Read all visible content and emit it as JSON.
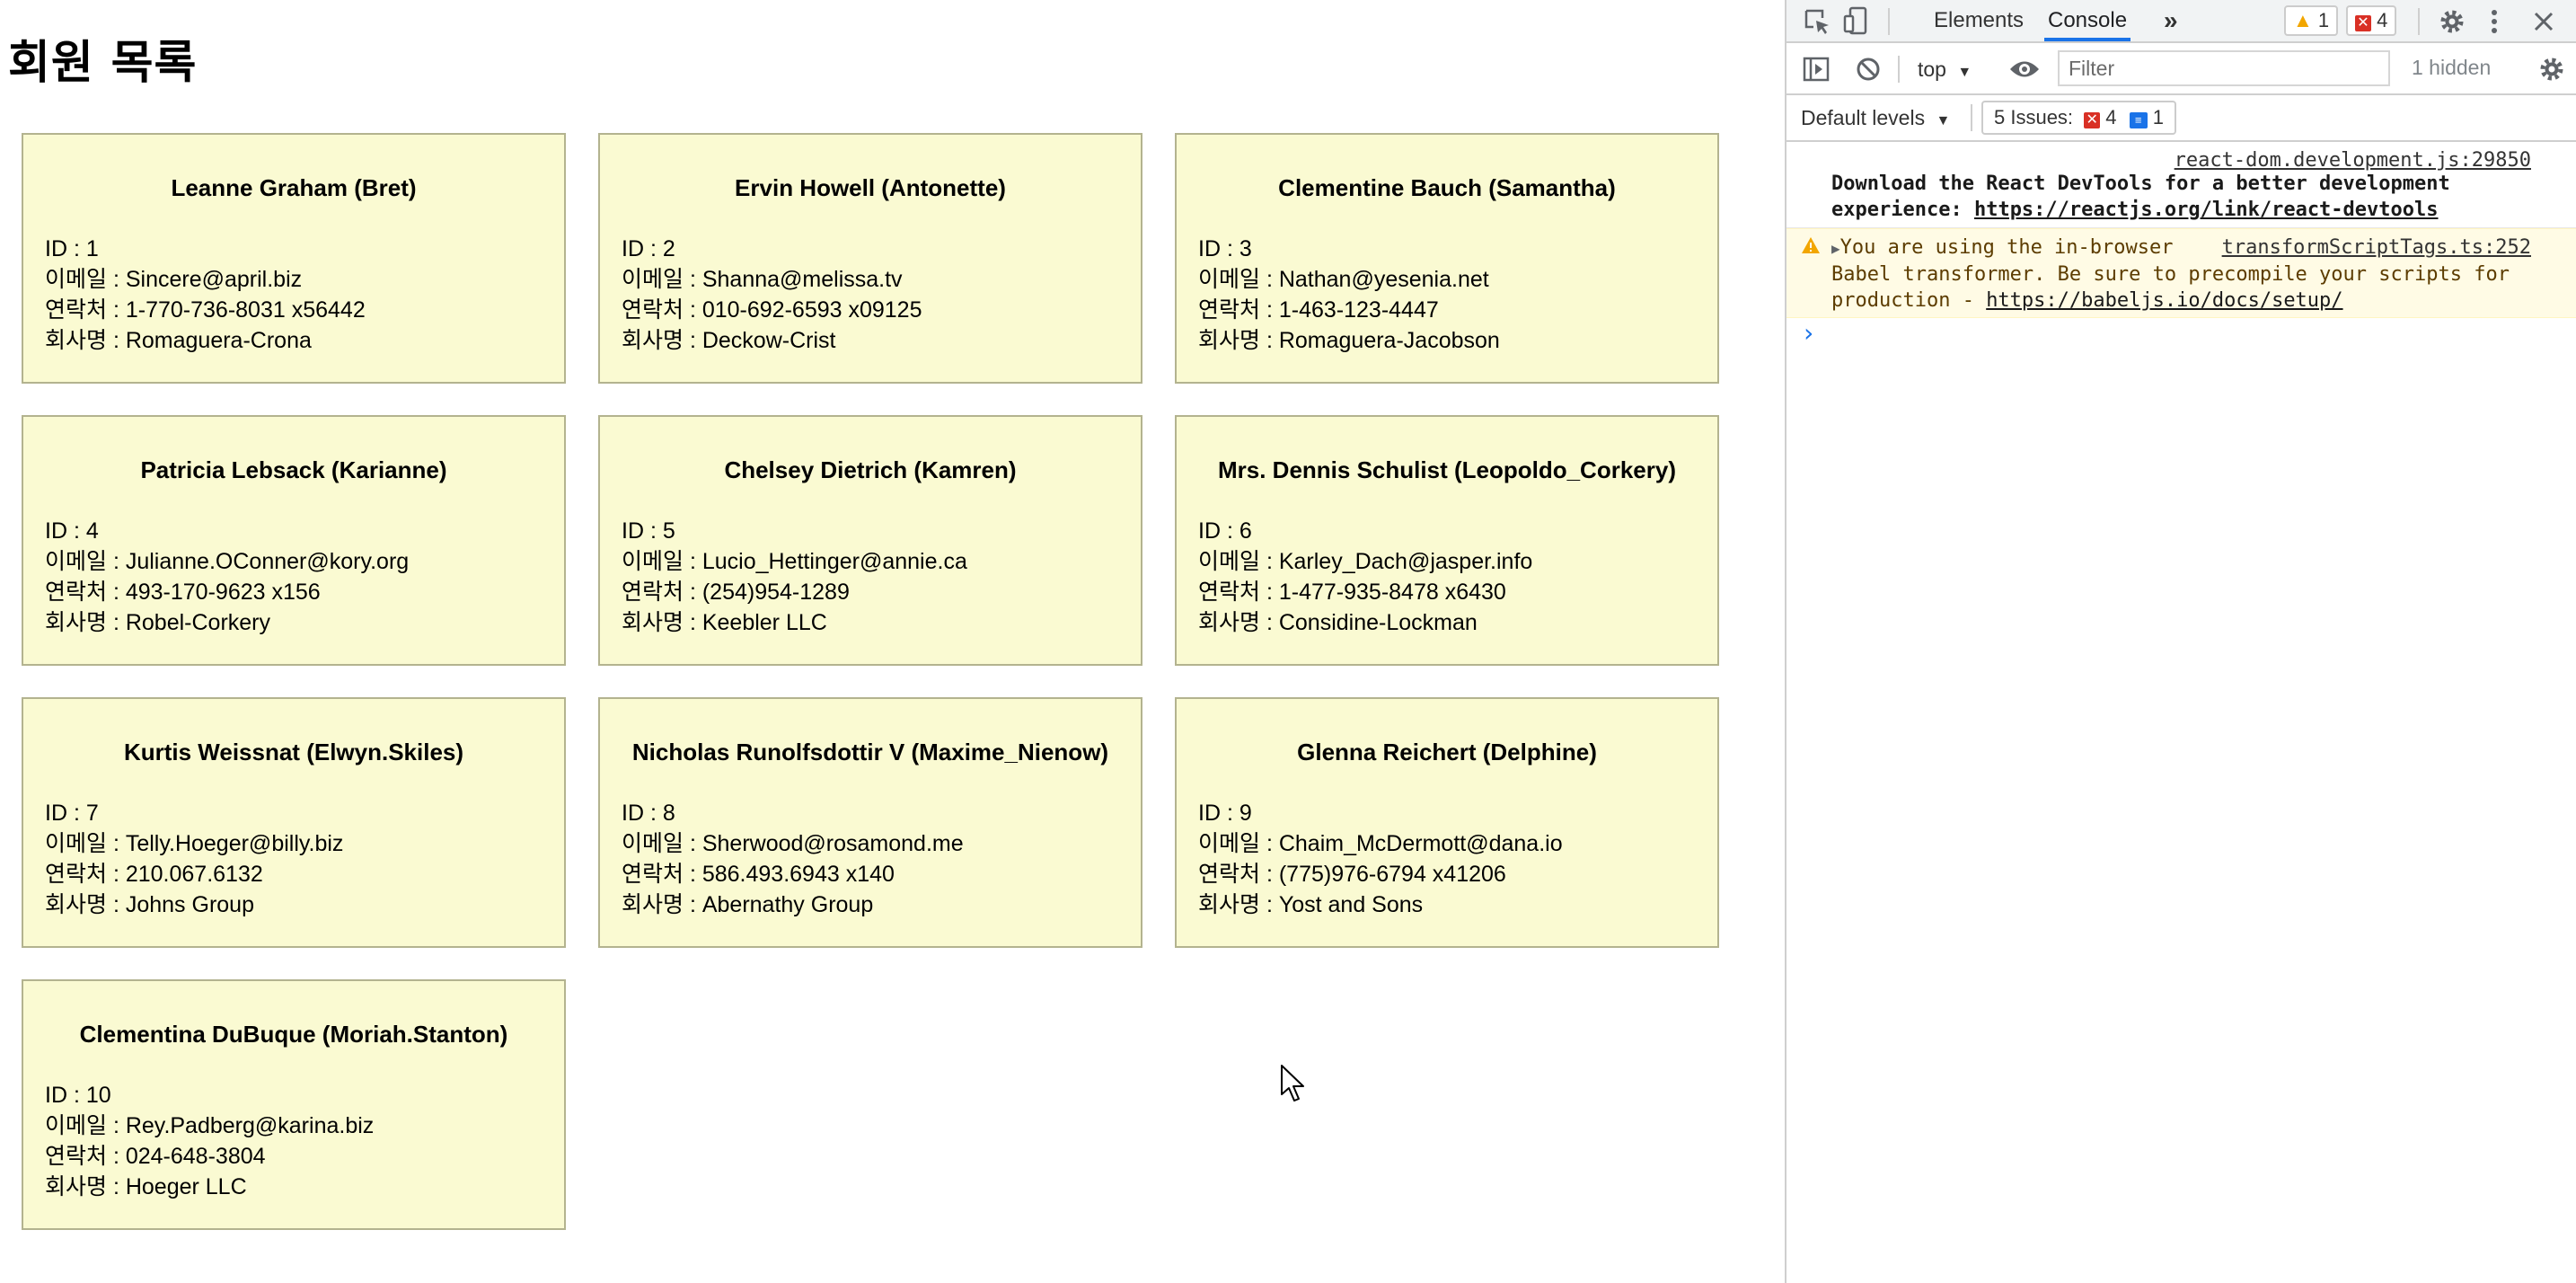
{
  "page": {
    "title": "회원 목록",
    "members": [
      {
        "name": "Leanne Graham (Bret)",
        "id": "ID : 1",
        "email": "이메일 : Sincere@april.biz",
        "phone": "연락처 : 1-770-736-8031 x56442",
        "company": "회사명 : Romaguera-Crona"
      },
      {
        "name": "Ervin Howell (Antonette)",
        "id": "ID : 2",
        "email": "이메일 : Shanna@melissa.tv",
        "phone": "연락처 : 010-692-6593 x09125",
        "company": "회사명 : Deckow-Crist"
      },
      {
        "name": "Clementine Bauch (Samantha)",
        "id": "ID : 3",
        "email": "이메일 : Nathan@yesenia.net",
        "phone": "연락처 : 1-463-123-4447",
        "company": "회사명 : Romaguera-Jacobson"
      },
      {
        "name": "Patricia Lebsack (Karianne)",
        "id": "ID : 4",
        "email": "이메일 : Julianne.OConner@kory.org",
        "phone": "연락처 : 493-170-9623 x156",
        "company": "회사명 : Robel-Corkery"
      },
      {
        "name": "Chelsey Dietrich (Kamren)",
        "id": "ID : 5",
        "email": "이메일 : Lucio_Hettinger@annie.ca",
        "phone": "연락처 : (254)954-1289",
        "company": "회사명 : Keebler LLC"
      },
      {
        "name": "Mrs. Dennis Schulist (Leopoldo_Corkery)",
        "id": "ID : 6",
        "email": "이메일 : Karley_Dach@jasper.info",
        "phone": "연락처 : 1-477-935-8478 x6430",
        "company": "회사명 : Considine-Lockman"
      },
      {
        "name": "Kurtis Weissnat (Elwyn.Skiles)",
        "id": "ID : 7",
        "email": "이메일 : Telly.Hoeger@billy.biz",
        "phone": "연락처 : 210.067.6132",
        "company": "회사명 : Johns Group"
      },
      {
        "name": "Nicholas Runolfsdottir V (Maxime_Nienow)",
        "id": "ID : 8",
        "email": "이메일 : Sherwood@rosamond.me",
        "phone": "연락처 : 586.493.6943 x140",
        "company": "회사명 : Abernathy Group"
      },
      {
        "name": "Glenna Reichert (Delphine)",
        "id": "ID : 9",
        "email": "이메일 : Chaim_McDermott@dana.io",
        "phone": "연락처 : (775)976-6794 x41206",
        "company": "회사명 : Yost and Sons"
      },
      {
        "name": "Clementina DuBuque (Moriah.Stanton)",
        "id": "ID : 10",
        "email": "이메일 : Rey.Padberg@karina.biz",
        "phone": "연락처 : 024-648-3804",
        "company": "회사명 : Hoeger LLC"
      }
    ]
  },
  "devtools": {
    "tabs": {
      "elements": "Elements",
      "console": "Console",
      "more": "»"
    },
    "warning_count": "1",
    "error_count": "4",
    "context": "top",
    "filter_placeholder": "Filter",
    "hidden": "1 hidden",
    "levels": "Default levels",
    "issues_label": "5 Issues:",
    "issues_errors": "4",
    "issues_info": "1",
    "messages": {
      "msg1_source": "react-dom.development.js:29850",
      "msg1_line1": "Download the React DevTools for a better development",
      "msg1_line2_prefix": "experience: ",
      "msg1_link": "https://reactjs.org/link/react-devtools",
      "msg2_source": "transformScriptTags.ts:252",
      "msg2_line1": "You are using the in-browser",
      "msg2_line2": "Babel transformer. Be sure to precompile your scripts for",
      "msg2_line3_prefix": "production - ",
      "msg2_link": "https://babeljs.io/docs/setup/",
      "prompt": "›"
    },
    "colors": {
      "accent": "#1a73e8",
      "warning": "#f2a600",
      "error": "#d93025",
      "card_bg": "#fafad2"
    }
  }
}
